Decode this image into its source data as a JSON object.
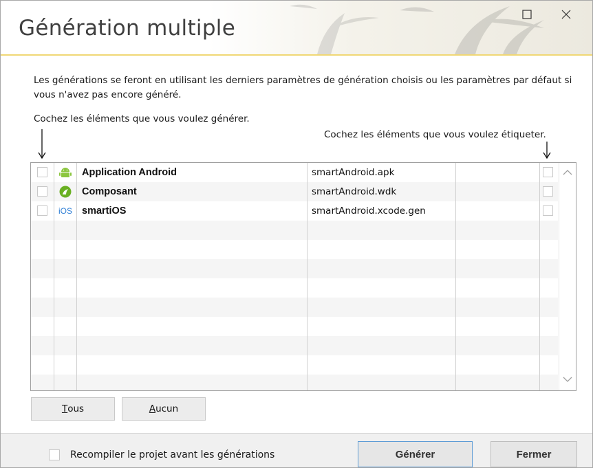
{
  "dialog": {
    "title": "Génération multiple",
    "description": "Les générations se feront en utilisant les derniers paramètres de génération choisis ou les paramètres par défaut si vous n'avez pas encore généré.",
    "hint_generate": "Cochez les éléments que vous voulez générer.",
    "hint_label": "Cochez les éléments que vous voulez étiqueter."
  },
  "configs": [
    {
      "name": "Application Android",
      "file": "smartAndroid.apk",
      "icon": "android-icon",
      "checked": false,
      "labeled": false
    },
    {
      "name": "Composant",
      "file": "smartAndroid.wdk",
      "icon": "component-icon",
      "checked": false,
      "labeled": false
    },
    {
      "name": "smartiOS",
      "file": "smartAndroid.xcode.gen",
      "icon": "ios-icon",
      "checked": false,
      "labeled": false
    }
  ],
  "ios_badge": "iOS",
  "buttons": {
    "tous_ul": "T",
    "tous_rest": "ous",
    "aucun_ul": "A",
    "aucun_rest": "ucun",
    "generate": "Générer",
    "close": "Fermer"
  },
  "footer": {
    "recompile_label": "Recompiler le projet avant les générations",
    "recompile_checked": false
  },
  "colors": {
    "header_underline": "#f0d774",
    "android_green": "#8cc63f",
    "component_green": "#6ab023",
    "ios_blue": "#2f7fd6",
    "default_button_border": "#5b9bd5"
  }
}
